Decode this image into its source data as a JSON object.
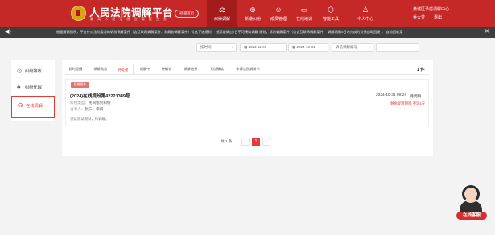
{
  "header": {
    "title": "人民法院调解平台",
    "subtitle": "最 高 人 民 法 院 立 案 庭 主 办",
    "return_label": "返回首页",
    "nav": [
      {
        "label": "纠纷调解",
        "icon": "gavel-icon"
      },
      {
        "label": "新增纠纷",
        "icon": "plus-icon"
      },
      {
        "label": "成员管理",
        "icon": "user-icon"
      },
      {
        "label": "在线培训",
        "icon": "monitor-icon"
      },
      {
        "label": "智能工具",
        "icon": "toolbox-icon"
      },
      {
        "label": "个人中心",
        "icon": "person-icon"
      }
    ],
    "org": "黄城区矛盾调解中心",
    "user": "乔大芳",
    "logout": "退出"
  },
  "notice": {
    "text": "根据最高指示，平台针对法院委派的诉前调解案件（含互联网调解案件、和解协调解案件）优化下述规则：“纸案说调过7日不可接收调解”规则，诉前调解案件（包含互联网调解案件）“调解期限5日内完成的负债自动回退”，“自动回收案"
  },
  "filters": [
    {
      "label": "按时间"
    },
    {
      "label": "2023-11-01"
    },
    {
      "label": "2024-10-31"
    },
    {
      "label": "诉前调解编号"
    }
  ],
  "sidebar": {
    "items": [
      {
        "label": "纠纷接收",
        "icon": "target-icon"
      },
      {
        "label": "纠纷化解",
        "icon": "people-icon"
      },
      {
        "label": "在线调解",
        "icon": "headset-icon"
      }
    ]
  },
  "tabs": [
    {
      "label": "即时提醒"
    },
    {
      "label": "调解动态"
    },
    {
      "label": "待处理"
    },
    {
      "label": "调解中"
    },
    {
      "label": "待确认"
    },
    {
      "label": "调解结果"
    },
    {
      "label": "司法确认"
    },
    {
      "label": "申请法院调解书"
    }
  ],
  "count_label": "1 件",
  "case": {
    "badge": "疑难案件 ",
    "number": "(2024)在线提纷第42221389号",
    "time": "2024-10-31 09:24",
    "status": "待调解",
    "remaining": "剩余受理期限 不足1天",
    "type_label": "纠纷类型：",
    "type_value": "民间借贷纠纷",
    "party_label": "当事人：",
    "party_value": "张三；李四",
    "desc": "测试测试测试，待调解。"
  },
  "pager": {
    "total": "共 1 条",
    "prev": "‹",
    "page": "1",
    "next": "›"
  },
  "service": {
    "label": "在线客服"
  }
}
